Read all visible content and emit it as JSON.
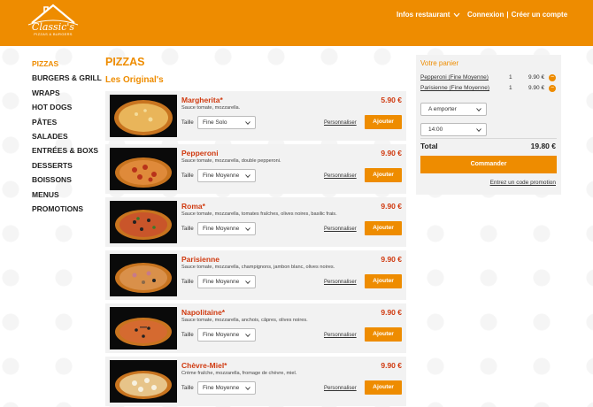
{
  "brand": {
    "name": "Classic's",
    "tagline": "PIZZAS & BURGERS"
  },
  "header": {
    "info_menu": "Infos restaurant",
    "login": "Connexion",
    "separator": "|",
    "signup": "Créer un compte"
  },
  "sidebar": {
    "items": [
      {
        "label": "PIZZAS",
        "active": true
      },
      {
        "label": "BURGERS & GRILL"
      },
      {
        "label": "WRAPS"
      },
      {
        "label": "HOT DOGS"
      },
      {
        "label": "PÂTES"
      },
      {
        "label": "SALADES"
      },
      {
        "label": "ENTRÉES & BOXS"
      },
      {
        "label": "DESSERTS"
      },
      {
        "label": "BOISSONS"
      },
      {
        "label": "MENUS"
      },
      {
        "label": "PROMOTIONS"
      }
    ]
  },
  "main": {
    "title": "PIZZAS",
    "section": "Les Original's",
    "size_label": "Taille",
    "customize_label": "Personnaliser",
    "add_label": "Ajouter",
    "products": [
      {
        "name": "Margherita*",
        "price": "5.90 €",
        "desc": "Sauce tomate, mozzarella.",
        "size": "Fine Solo"
      },
      {
        "name": "Pepperoni",
        "price": "9.90 €",
        "desc": "Sauce tomate, mozzarella, double pepperoni.",
        "size": "Fine Moyenne"
      },
      {
        "name": "Roma*",
        "price": "9.90 €",
        "desc": "Sauce tomate, mozzarella, tomates fraîches, olives noires, basilic frais.",
        "size": "Fine Moyenne"
      },
      {
        "name": "Parisienne",
        "price": "9.90 €",
        "desc": "Sauce tomate, mozzarella, champignons, jambon blanc, olives noires.",
        "size": "Fine Moyenne"
      },
      {
        "name": "Napolitaine*",
        "price": "9.90 €",
        "desc": "Sauce tomate, mozzarella, anchois, câpres, olives noires.",
        "size": "Fine Moyenne"
      },
      {
        "name": "Chèvre-Miel*",
        "price": "9.90 €",
        "desc": "Crème fraîche, mozzarella, fromage de chèvre, miel.",
        "size": "Fine Moyenne"
      }
    ]
  },
  "cart": {
    "title": "Votre panier",
    "lines": [
      {
        "name": "Pepperoni (Fine Moyenne)",
        "qty": "1",
        "price": "9.90 €",
        "remove": "−"
      },
      {
        "name": "Parisienne (Fine Moyenne)",
        "qty": "1",
        "price": "9.90 €",
        "remove": "−"
      }
    ],
    "mode": "A emporter",
    "time": "14:00",
    "total_label": "Total",
    "total_value": "19.80 €",
    "order_label": "Commander",
    "promo_label": "Entrez un code promotion"
  },
  "colors": {
    "accent": "#ee8c00",
    "product_name": "#d03a10",
    "panel": "#f2f2f2"
  }
}
